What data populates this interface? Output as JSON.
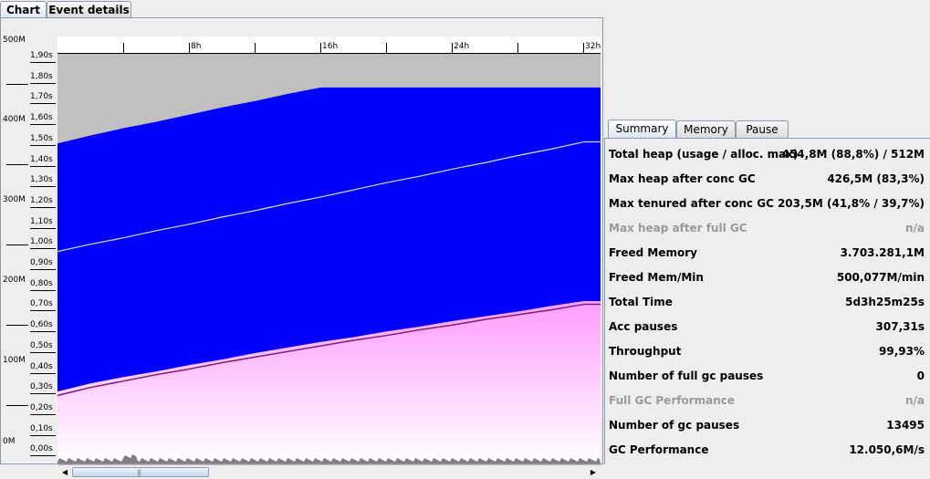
{
  "tabs": [
    {
      "label": "Chart",
      "active": true
    },
    {
      "label": "Event details",
      "active": false
    }
  ],
  "axis": {
    "memory_labels": [
      "500M",
      "400M",
      "300M",
      "200M",
      "100M",
      "0M"
    ],
    "pause_labels": [
      "1,90s",
      "1,80s",
      "1,70s",
      "1,60s",
      "1,50s",
      "1,40s",
      "1,30s",
      "1,20s",
      "1,10s",
      "1,00s",
      "0,90s",
      "0,80s",
      "0,70s",
      "0,60s",
      "0,50s",
      "0,40s",
      "0,30s",
      "0,20s",
      "0,10s",
      "0,00s"
    ],
    "time_labels": [
      "8h",
      "16h",
      "24h",
      "32h"
    ]
  },
  "chart_data": {
    "type": "area",
    "x": [
      0,
      2,
      4,
      6,
      8,
      10,
      12,
      14,
      16,
      18,
      20,
      22,
      24,
      26,
      28,
      30,
      32
    ],
    "x_unit": "h",
    "xlim": [
      0,
      33
    ],
    "ylim_memory": [
      0,
      512
    ],
    "ylim_pause": [
      0,
      1.95
    ],
    "series": [
      {
        "values": [
          512,
          512,
          512,
          512,
          512,
          512,
          512,
          512,
          512,
          512,
          512,
          512,
          512,
          512,
          512,
          512,
          512
        ],
        "color": "#c0c0c0"
      },
      {
        "values": [
          400,
          410,
          419,
          427,
          436,
          445,
          453,
          462,
          470,
          470,
          470,
          470,
          470,
          470,
          470,
          470,
          470
        ],
        "color": "#0000ff"
      },
      {
        "values": [
          90,
          100,
          108,
          115,
          123,
          130,
          138,
          145,
          152,
          158,
          165,
          171,
          178,
          184,
          190,
          197,
          203
        ],
        "color": "#ffb6ff"
      },
      {
        "values": [
          265,
          274,
          282,
          291,
          299,
          308,
          316,
          325,
          333,
          342,
          351,
          359,
          368,
          376,
          385,
          393,
          402
        ],
        "color": "#d8d8d8"
      },
      {
        "values": [
          85,
          95,
          103,
          111,
          118,
          126,
          133,
          140,
          147,
          154,
          160,
          167,
          173,
          180,
          186,
          192,
          199
        ],
        "color": "#7a1f7a"
      }
    ],
    "colors": {
      "total_heap": "#c0c0c0",
      "used_heap": "#0000ff",
      "tenured": "#ffb6ff",
      "tenured_line": "#7a1f7a",
      "gc_pauses": "#808080"
    }
  },
  "summary": {
    "tabs": [
      {
        "label": "Summary",
        "active": true
      },
      {
        "label": "Memory",
        "active": false
      },
      {
        "label": "Pause",
        "active": false
      }
    ],
    "rows": [
      {
        "label": "Total heap (usage / alloc. max)",
        "value": "454,8M (88,8%) / 512M",
        "enabled": true
      },
      {
        "label": "Max heap after conc GC",
        "value": "426,5M (83,3%)",
        "enabled": true
      },
      {
        "label": "Max tenured after conc GC",
        "value": "203,5M (41,8% / 39,7%)",
        "enabled": true
      },
      {
        "label": "Max heap after full GC",
        "value": "n/a",
        "enabled": false
      },
      {
        "label": "Freed Memory",
        "value": "3.703.281,1M",
        "enabled": true
      },
      {
        "label": "Freed Mem/Min",
        "value": "500,077M/min",
        "enabled": true
      },
      {
        "label": "Total Time",
        "value": "5d3h25m25s",
        "enabled": true
      },
      {
        "label": "Acc pauses",
        "value": "307,31s",
        "enabled": true
      },
      {
        "label": "Throughput",
        "value": "99,93%",
        "enabled": true
      },
      {
        "label": "Number of full gc pauses",
        "value": "0",
        "enabled": true
      },
      {
        "label": "Full GC Performance",
        "value": "n/a",
        "enabled": false
      },
      {
        "label": "Number of gc pauses",
        "value": "13495",
        "enabled": true
      },
      {
        "label": "GC Performance",
        "value": "12.050,6M/s",
        "enabled": true
      }
    ]
  }
}
